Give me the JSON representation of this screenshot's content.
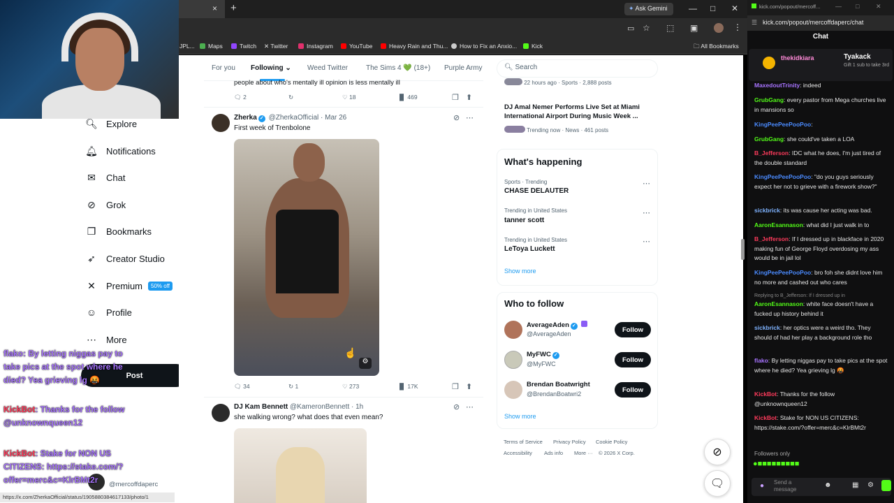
{
  "browser": {
    "gemini_label": "Ask Gemini",
    "tab_close": "×",
    "new_tab": "+",
    "bookmarks": [
      {
        "label": "JPL...",
        "color": "#e9e9e9"
      },
      {
        "label": "Maps",
        "color": "#4caf50"
      },
      {
        "label": "Twitch",
        "color": "#9146ff"
      },
      {
        "label": "Twitter",
        "color": "#ffffff"
      },
      {
        "label": "Instagram",
        "color": "#e1306c"
      },
      {
        "label": "YouTube",
        "color": "#ff0000"
      },
      {
        "label": "Heavy Rain and Thu...",
        "color": "#ff0000"
      },
      {
        "label": "How to Fix an Anxio...",
        "color": "#cccccc"
      },
      {
        "label": "Kick",
        "color": "#53fc18"
      },
      {
        "label": "All Bookmarks",
        "color": "#cccccc"
      }
    ],
    "status_url": "https://x.com/ZherkaOfficial/status/1905880384617133/photo/1"
  },
  "nav": {
    "items": [
      {
        "label": "Explore",
        "icon": "search-icon"
      },
      {
        "label": "Notifications",
        "icon": "bell-icon"
      },
      {
        "label": "Chat",
        "icon": "mail-icon"
      },
      {
        "label": "Grok",
        "icon": "grok-icon"
      },
      {
        "label": "Bookmarks",
        "icon": "bookmark-icon"
      },
      {
        "label": "Creator Studio",
        "icon": "rocket-icon"
      },
      {
        "label": "Premium",
        "icon": "x-icon"
      },
      {
        "label": "Profile",
        "icon": "person-icon"
      },
      {
        "label": "More",
        "icon": "more-circle-icon"
      }
    ],
    "premium_badge": "50% off",
    "post_label": "Post",
    "user_handle": "@mercoffdaperc",
    "user_more": "···"
  },
  "overlay_chat": [
    {
      "user": "flako",
      "text": ": By letting niggas pay to take pics at the spot where he died? Yea grieving lg 🤬",
      "color": "#a874ff"
    },
    {
      "user": "KickBot",
      "text": ": Thanks for the follow @unknownqueen12",
      "color": "#ff3b5c"
    },
    {
      "user": "KickBot",
      "text": ": Stake for NON US CITIZENS: https://stake.com/?offer=merc&c=KlrBMt2r",
      "color": "#ff3b5c"
    }
  ],
  "feed": {
    "tabs": [
      "For you",
      "Following",
      "Weed Twitter",
      "The Sims 4 💚 (18+)",
      "Purple Army"
    ],
    "prev_text": "people about who's mentally ill opinion is less mentally ill",
    "prev_actions": {
      "replies": "2",
      "reposts": "",
      "likes": "18",
      "views": "469"
    },
    "tweet1": {
      "name": "Zherka",
      "handle": "@ZherkaOfficial",
      "date": "Mar 26",
      "text": "First week of Trenbolone",
      "actions": {
        "replies": "34",
        "reposts": "1",
        "likes": "273",
        "views": "17K"
      }
    },
    "tweet2": {
      "name": "DJ Kam Bennett",
      "handle": "@KameronBennett",
      "date": "1h",
      "text": "she walking wrong? what does that even mean?"
    }
  },
  "sidebar": {
    "search_placeholder": "Search",
    "top_meta": "22 hours ago · Sports · 2,888 posts",
    "news_title": "DJ Amal Nemer Performs Live Set at Miami International Airport During Music Week ...",
    "news_meta": "Trending now · News · 461 posts",
    "happening_title": "What's happening",
    "trends": [
      {
        "context": "Sports · Trending",
        "title": "CHASE DELAUTER"
      },
      {
        "context": "Trending in United States",
        "title": "tanner scott"
      },
      {
        "context": "Trending in United States",
        "title": "LeToya Luckett"
      }
    ],
    "show_more": "Show more",
    "who_title": "Who to follow",
    "follows": [
      {
        "name": "AverageAden",
        "handle": "@AverageAden"
      },
      {
        "name": "MyFWC",
        "handle": "@MyFWC"
      },
      {
        "name": "Brendan Boatwright",
        "handle": "@BrendanBoatwri2"
      }
    ],
    "follow_label": "Follow",
    "footer": [
      "Terms of Service",
      "Privacy Policy",
      "Cookie Policy",
      "Accessibility",
      "Ads info",
      "More ···",
      "© 2026 X Corp."
    ]
  },
  "kick": {
    "popout_url": "kick.com/popout/mercoff...",
    "url": "kick.com/popout/mercoffdaperc/chat",
    "title": "Chat",
    "pinned_user": "thekidkiara",
    "pinned_user2": "Tyakack",
    "pinned_text": "Gift 1 sub to take 3rd",
    "messages": [
      {
        "user": "MaxedoutTrinity",
        "color": "#a874ff",
        "text": ": indeed"
      },
      {
        "user": "GrubGang",
        "color": "#53fc18",
        "text": ": every pastor from Mega churches live in mansions so"
      },
      {
        "user": "KingPeePeePooPoo",
        "color": "#4b8bff",
        "text": ":"
      },
      {
        "user": "GrubGang",
        "color": "#53fc18",
        "text": ": she could've taken a LOA"
      },
      {
        "user": "B_Jefferson",
        "color": "#ff3b5c",
        "text": ": IDC what he does, I'm just tired of the double standard"
      },
      {
        "user": "KingPeePeePooPoo",
        "color": "#4b8bff",
        "text": ": \"do you guys seriously expect her not to grieve with a firework show?\""
      },
      {
        "user": "sickbrick",
        "color": "#7fb3ff",
        "text": ": its was cause her acting was bad."
      },
      {
        "user": "AaronEsannason",
        "color": "#53fc18",
        "text": ": what did I just walk in to"
      },
      {
        "user": "B_Jefferson",
        "color": "#ff3b5c",
        "text": ": If I dressed up in blackface in 2020 making fun of George Floyd overdosing my ass would be in jail lol"
      },
      {
        "user": "KingPeePeePooPoo",
        "color": "#4b8bff",
        "text": ": bro foh she didnt love him no more and cashed out who cares"
      },
      {
        "user": "Replying to B_Jefferson: If I dressed up in",
        "color": "#888888",
        "text": ""
      },
      {
        "user": "AaronEsannason",
        "color": "#53fc18",
        "text": ": white face doesn't have a fucked up history behind it"
      },
      {
        "user": "sickbrick",
        "color": "#7fb3ff",
        "text": ": her optics were a weird tho. They should of had her play a background role tho"
      },
      {
        "user": "flako",
        "color": "#a874ff",
        "text": ": By letting niggas pay to take pics at the spot where he died? Yea grieving lg 🤬"
      },
      {
        "user": "KickBot",
        "color": "#ff3b5c",
        "text": ": Thanks for the follow @unknownqueen12"
      },
      {
        "user": "KickBot",
        "color": "#ff3b5c",
        "text": ": Stake for NON US CITIZENS: https://stake.com/?offer=merc&c=KlrBMt2r"
      }
    ],
    "followers_only": "Followers only",
    "input_placeholder": "Send a message"
  }
}
